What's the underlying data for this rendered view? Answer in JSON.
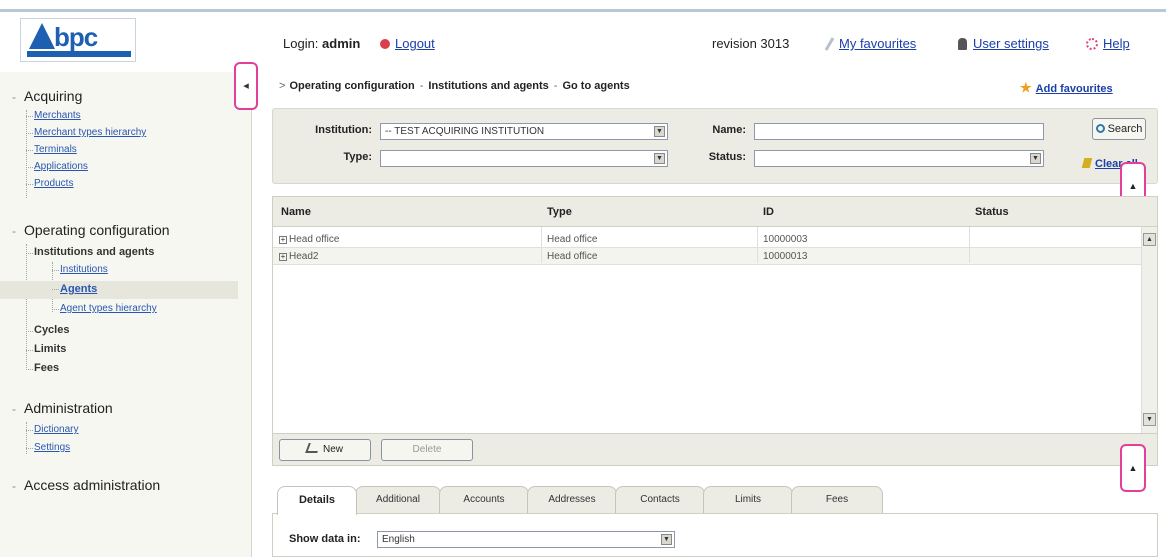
{
  "header": {
    "login_label": "Login:",
    "login_user": "admin",
    "logout": "Logout",
    "revision": "revision 3013",
    "my_favourites": "My favourites",
    "user_settings": "User settings",
    "help": "Help"
  },
  "sidebar": {
    "sections": [
      {
        "title": "Acquiring",
        "items": [
          "Merchants",
          "Merchant types hierarchy",
          "Terminals",
          "Applications",
          "Products"
        ]
      },
      {
        "title": "Operating configuration",
        "group": "Institutions and agents",
        "subitems": [
          "Institutions",
          "Agents",
          "Agent types hierarchy"
        ],
        "items": [
          "Cycles",
          "Limits",
          "Fees"
        ]
      },
      {
        "title": "Administration",
        "items": [
          "Dictionary",
          "Settings"
        ]
      },
      {
        "title": "Access administration"
      }
    ],
    "collapse_glyph": "◂"
  },
  "breadcrumb": [
    "Operating configuration",
    "Institutions and agents",
    "Go to agents"
  ],
  "add_favourites": "Add favourites",
  "filter": {
    "institution_label": "Institution:",
    "institution_value": "-- TEST ACQUIRING INSTITUTION",
    "type_label": "Type:",
    "type_value": "",
    "name_label": "Name:",
    "name_value": "",
    "status_label": "Status:",
    "status_value": "",
    "search_button": "Search",
    "clear_all": "Clear all"
  },
  "grid": {
    "columns": [
      "Name",
      "Type",
      "ID",
      "Status"
    ],
    "rows": [
      {
        "name": "Head office",
        "type": "Head office",
        "id": "10000003",
        "status": ""
      },
      {
        "name": "Head2",
        "type": "Head office",
        "id": "10000013",
        "status": ""
      }
    ],
    "new_button": "New",
    "delete_button": "Delete"
  },
  "tabs": [
    "Details",
    "Additional",
    "Accounts",
    "Addresses",
    "Contacts",
    "Limits",
    "Fees"
  ],
  "details": {
    "show_data_label": "Show data in:",
    "language_value": "English"
  },
  "colors": {
    "accent": "#1a3fa8",
    "highlight_border": "#e0409a",
    "panel_bg": "#ecece4"
  }
}
